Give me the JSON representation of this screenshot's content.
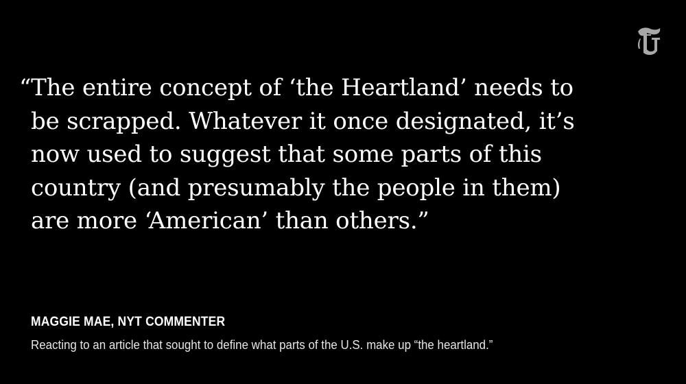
{
  "brand": {
    "logo_icon": "nyt-t-logo-icon",
    "logo_letter": "T",
    "background_color": "#000000",
    "text_color": "#ffffff"
  },
  "quote": {
    "lines": [
      "“The entire concept of ‘the Heartland’ needs to",
      "be scrapped. Whatever it once designated, it’s",
      "now used to suggest that some parts of this",
      "country (and presumably the people in them)",
      "are more ‘American’ than others.”"
    ]
  },
  "attribution": {
    "author": "MAGGIE MAE, NYT COMMENTER",
    "context": "Reacting to an article that sought to define what parts of the U.S. make up “the heartland.”"
  }
}
